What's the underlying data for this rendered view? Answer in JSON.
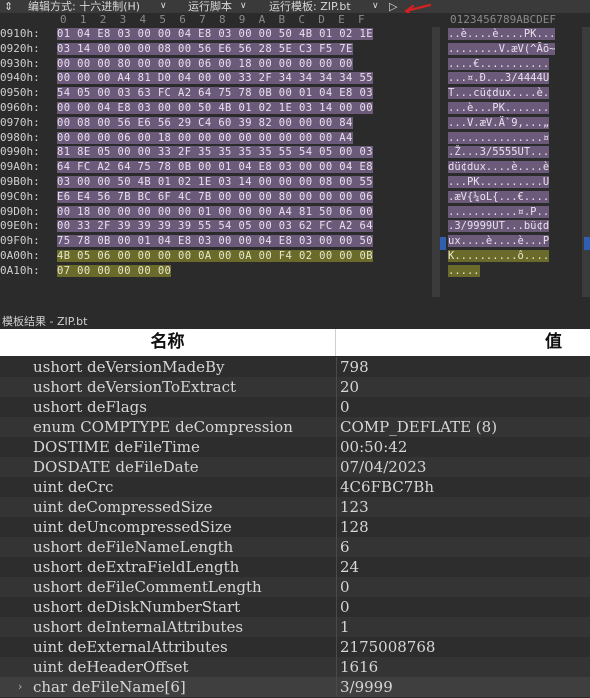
{
  "toolbar": {
    "menu_icon": "⇕",
    "edit_mode": "编辑方式: 十六进制(H)",
    "run_script": "运行脚本",
    "run_template": "运行模板: ZIP.bt",
    "play_icon": "▷",
    "annotation_color": "#d42020"
  },
  "hex_header": {
    "columns": "0  1  2  3  4  5  6  7  8  9  A  B  C  D  E  F",
    "ascii": "0123456789ABCDEF"
  },
  "hex_rows": [
    {
      "addr": "0910h:",
      "hex": "01 04 E8 03 00 00 04 E8 03 00 00 50 4B 01 02 1E",
      "ascii": "..è....è....PK..."
    },
    {
      "addr": "0920h:",
      "hex": "03 14 00 00 00 08 00 56 E6 56 28 5E C3 F5 7E",
      "ascii": "........V.æV(^Ãõ~"
    },
    {
      "addr": "0930h:",
      "hex": "00 00 00 80 00 00 00 06 00 18 00 00 00 00 00",
      "ascii": "....€..........."
    },
    {
      "addr": "0940h:",
      "hex": "00 00 00 A4 81 D0 04 00 00 33 2F 34 34 34 34 55",
      "ascii": "...¤.Ð...3/4444U"
    },
    {
      "addr": "0950h:",
      "hex": "54 05 00 03 63 FC A2 64 75 78 0B 00 01 04 E8 03",
      "ascii": "T...cü¢dux....è."
    },
    {
      "addr": "0960h:",
      "hex": "00 00 04 E8 03 00 00 50 4B 01 02 1E 03 14 00 00",
      "ascii": "...è...PK......."
    },
    {
      "addr": "0970h:",
      "hex": "00 08 00 56 E6 56 29 C4 60 39 82 00 00 00 84",
      "ascii": "...V.æV.Ä`9,...„"
    },
    {
      "addr": "0980h:",
      "hex": "00 00 00 06 00 18 00 00 00 00 00 00 00 00 A4",
      "ascii": "...............¤"
    },
    {
      "addr": "0990h:",
      "hex": "81 8E 05 00 00 33 2F 35 35 35 35 55 54 05 00 03",
      "ascii": ".Ž...3/5555UT..."
    },
    {
      "addr": "09A0h:",
      "hex": "64 FC A2 64 75 78 0B 00 01 04 E8 03 00 00 04 E8",
      "ascii": "dü¢dux....è....è"
    },
    {
      "addr": "09B0h:",
      "hex": "03 00 00 50 4B 01 02 1E 03 14 00 00 00 08 00 55",
      "ascii": "...PK..........U"
    },
    {
      "addr": "09C0h:",
      "hex": "E6 E4 56 7B BC 6F 4C 7B 00 00 00 80 00 00 00 06",
      "ascii": ".æV{¼oL{...€...."
    },
    {
      "addr": "09D0h:",
      "hex": "00 18 00 00 00 00 00 01 00 00 00 A4 81 50 06 00",
      "ascii": "...........¤.P.."
    },
    {
      "addr": "09E0h:",
      "hex": "00 33 2F 39 39 39 39 55 54 05 00 03 62 FC A2 64",
      "ascii": ".3/9999UT...bü¢d"
    },
    {
      "addr": "09F0h:",
      "hex": "75 78 0B 00 01 04 E8 03 00 00 04 E8 03 00 00 50",
      "ascii": "ux....è....è...P"
    },
    {
      "addr": "0A00h:",
      "hex": "4B 05 06 00 00 00 00 0A 00 0A 00 F4 02 00 00 0B",
      "ascii": "K..........ô...."
    },
    {
      "addr": "0A10h:",
      "hex": "07 00 00 00 00 00",
      "ascii": "....."
    }
  ],
  "panel": {
    "title": "模板结果 - ZIP.bt",
    "col_name": "名称",
    "col_value": "值"
  },
  "fields": [
    {
      "name": "ushort deVersionMadeBy",
      "value": "798"
    },
    {
      "name": "ushort deVersionToExtract",
      "value": "20"
    },
    {
      "name": "ushort deFlags",
      "value": "0"
    },
    {
      "name": "enum COMPTYPE deCompression",
      "value": "COMP_DEFLATE (8)"
    },
    {
      "name": "DOSTIME deFileTime",
      "value": "00:50:42"
    },
    {
      "name": "DOSDATE deFileDate",
      "value": "07/04/2023"
    },
    {
      "name": "uint deCrc",
      "value": "4C6FBC7Bh"
    },
    {
      "name": "uint deCompressedSize",
      "value": "123"
    },
    {
      "name": "uint deUncompressedSize",
      "value": "128"
    },
    {
      "name": "ushort deFileNameLength",
      "value": "6"
    },
    {
      "name": "ushort deExtraFieldLength",
      "value": "24"
    },
    {
      "name": "ushort deFileCommentLength",
      "value": "0"
    },
    {
      "name": "ushort deDiskNumberStart",
      "value": "0"
    },
    {
      "name": "ushort deInternalAttributes",
      "value": "1"
    },
    {
      "name": "uint deExternalAttributes",
      "value": "2175008768"
    },
    {
      "name": "uint deHeaderOffset",
      "value": "1616"
    },
    {
      "name": "char deFileName[6]",
      "value": "3/9999",
      "expandable": true
    }
  ]
}
